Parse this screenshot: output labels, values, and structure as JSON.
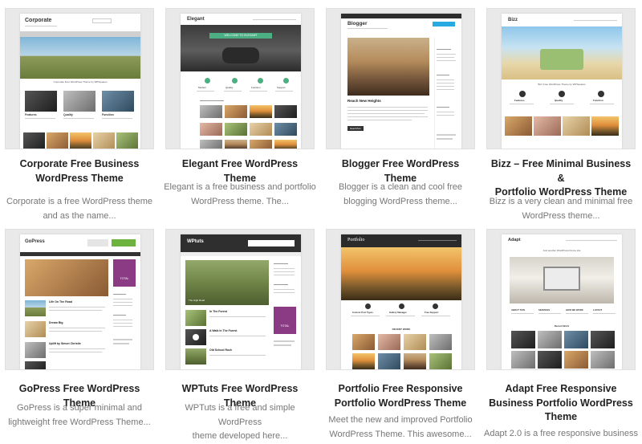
{
  "themes": [
    {
      "title_lines": [
        "Corporate Free Business",
        "WordPress Theme"
      ],
      "desc_lines": [
        "Corporate is a free WordPress theme",
        "and as the name..."
      ],
      "preview": {
        "logo": "Corporate",
        "banner": "Corporate Free WordPress Theme by WPSquares",
        "features": [
          "Features",
          "Quality",
          "Function"
        ]
      }
    },
    {
      "title_lines": [
        "Elegant Free WordPress Theme"
      ],
      "desc_lines": [
        "Elegant is a free business and portfolio",
        "WordPress theme. The..."
      ],
      "preview": {
        "logo": "Elegant",
        "banner": "WELCOME TO ELEGANT",
        "features": [
          "Modern",
          "Quality",
          "Function",
          "Support"
        ]
      }
    },
    {
      "title_lines": [
        "Blogger Free WordPress Theme"
      ],
      "desc_lines": [
        "Blogger is a clean and cool free",
        "blogging WordPress theme..."
      ],
      "preview": {
        "logo": "Blogger",
        "post_title": "Reach New Heights",
        "button": "Read More"
      }
    },
    {
      "title_lines": [
        "Bizz – Free Minimal Business &",
        "Portfolio WordPress Theme"
      ],
      "desc_lines": [
        "Bizz is a very clean and minimal free",
        "WordPress theme..."
      ],
      "preview": {
        "logo": "Bizz",
        "banner": "Bizz Free WordPress Theme by WPSquares",
        "features": [
          "Features",
          "Quality",
          "Function"
        ]
      }
    },
    {
      "title_lines": [
        "GoPress Free WordPress Theme"
      ],
      "desc_lines": [
        "GoPress is a super minimal and",
        "lightweight free WordPress Theme..."
      ],
      "preview": {
        "logo": "GoPress",
        "posts": [
          "Life On The Road",
          "Dream Big",
          "Uplift by Simon Christie"
        ],
        "ad": "TOTAL"
      }
    },
    {
      "title_lines": [
        "WPTuts Free WordPress Theme"
      ],
      "desc_lines": [
        "WPTuts is a free and simple WordPress",
        "theme developed here..."
      ],
      "preview": {
        "logo": "WPtuts",
        "posts": [
          "The High Road",
          "In The Forest",
          "A Walk In The Forest",
          "Old School Rock"
        ],
        "ad": "TOTAL"
      }
    },
    {
      "title_lines": [
        "Portfolio Free Responsive",
        "Portfolio WordPress Theme"
      ],
      "desc_lines": [
        "Meet the new and improved Portfolio",
        "WordPress Theme. This awesome..."
      ],
      "preview": {
        "logo": "Portfolio",
        "features": [
          "Custom Post Types",
          "Gallery Manager",
          "Free Support"
        ],
        "section": "RECENT WORK"
      }
    },
    {
      "title_lines": [
        "Adapt Free Responsive",
        "Business Portfolio WordPress",
        "Theme"
      ],
      "desc_lines": [
        "Adapt 2.0 is a free responsive business"
      ],
      "preview": {
        "logo": "Adapt",
        "tagline": "Just another WordPress theme site",
        "features": [
          "ABOUT THIS",
          "SERVICES",
          "HOW WE WORK",
          "LAYOUT"
        ],
        "section": "Recent Work"
      }
    }
  ]
}
